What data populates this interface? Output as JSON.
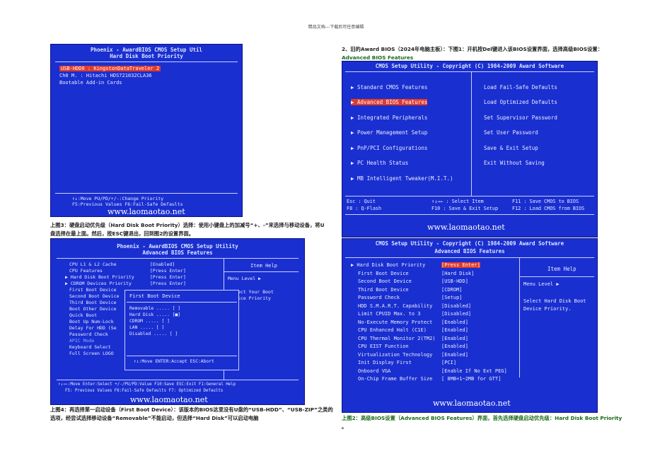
{
  "page": {
    "header": "精品文档---下载后可任意编辑"
  },
  "intro": {
    "text": "2、旧的Award BIOS（2024年电脑主板）：下图1：开机按Del键进入该BIOS设置界面，选择高级BIOS设置：",
    "highlight": "Advanced BIOS Features"
  },
  "shot_tl": {
    "title1": "Phoenix - AwardBIOS CMOS Setup Util",
    "title2": "Hard Disk Boot Priority",
    "items": [
      "USB-HDD0   :  KingstonDataTraveler 2",
      "Ch0 M.     :  Hitachi HDS721032CLA36",
      "Bootable Add-in Cards"
    ],
    "footer1": "↑↓:Move    PU/PD/+/-:Change Priority",
    "footer2": "F5:Previous Values    F6:Fail-Safe Defaults",
    "watermark": "www.laomaotao.net"
  },
  "caption3": "上图3：硬盘启动优先级（Hard Disk Boot Priority）选择：使用小键盘上的加减号“+、-”来选择与移动设备，将U盘选择在最上面。然后，按ESC键退出，回到图2的设置界面。",
  "shot_tr": {
    "title": "CMOS Setup Utility - Copyright (C) 1984-2009 Award Software",
    "left_items": [
      "▶ Standard CMOS Features",
      "▶ Advanced BIOS Features",
      "▶ Integrated Peripherals",
      "▶ Power Management Setup",
      "▶ PnP/PCI Configurations",
      "▶ PC Health Status",
      "▶ MB Intelligent Tweaker(M.I.T.)"
    ],
    "right_items": [
      "Load Fail-Safe Defaults",
      "Load Optimized Defaults",
      "Set Supervisor Password",
      "Set User Password",
      "Save & Exit Setup",
      "Exit Without Saving"
    ],
    "foot_l1": "Esc : Quit",
    "foot_l2": "F8  : Q-Flash",
    "foot_m1": "↑↓→← : Select Item",
    "foot_m2": "F10 : Save & Exit Setup",
    "foot_r1": "F11 : Save CMOS to BIOS",
    "foot_r2": "F12 : Load CMOS from BIOS",
    "watermark": "www.laomaotao.net"
  },
  "shot_bl": {
    "title1": "Phoenix - AwardBIOS CMOS Setup Utility",
    "title2": "Advanced BIOS Features",
    "items": [
      "CPU L1 & L2 Cache",
      "CPU Features",
      "▶ Hard Disk Boot Priority",
      "▶ CDROM Devices Priority",
      "First Boot Device",
      "Second Boot Device",
      "Third Boot Device",
      "Boot Other Device",
      "Quick Boot",
      "Boot Up Num-Lock",
      "Delay For HDD (Se",
      "Password Check",
      "APIC Mode",
      "Keyboard Select",
      "Full Screen LOGO"
    ],
    "values": [
      "[Enabled]",
      "[Press Enter]",
      "[Press Enter]",
      "[Press Enter]"
    ],
    "help_title": "Item Help",
    "help_menu": "Menu Level  ▶",
    "help_text": "ect Your Boot",
    "help_text2": "ice Priority",
    "popup_title": "First Boot Device",
    "popup_items": [
      "Removable      ..... [ ]",
      "Hard Disk      ..... [■]",
      "CDROM          ..... [ ]",
      "LAN            ..... [ ]",
      "Disabled       ..... [ ]"
    ],
    "popup_footer": "↑↓:Move ENTER:Accept ESC:Abort",
    "footer1": "↑↓→←:Move  Enter:Select  +/-/PU/PD:Value  F10:Save  ESC:Exit  F1:General Help",
    "footer2": "F5: Previous Values    F6:Fail-Safe Defaults    F7: Optimized Defaults",
    "watermark": "www.laomaotao.net"
  },
  "caption4": "上图4：再选择第一启动设备（First Boot Device）：该版本的BIOS这里没有U盘的“USB-HDD”、“USB-ZIP”之类的选项，经尝试选择移动设备“Removable”不能启动，但选择“Hard Disk”可以启动电脑",
  "shot_br": {
    "title1": "CMOS Setup Utility - Copyright (C) 1984-2009 Award Software",
    "title2": "Advanced BIOS Features",
    "items": [
      "▶ Hard Disk Boot Priority",
      "First Boot Device",
      "Second Boot Device",
      "Third Boot Device",
      "Password Check",
      "HDD S.M.A.R.T. Capability",
      "Limit CPUID Max. to 3",
      "No-Execute Memory Protect",
      "CPU Enhanced Halt (C1E)",
      "CPU Thermal Monitor 2(TM2)",
      "CPU EIST Function",
      "Virtualization Technology",
      "Init Display First",
      "Onboard VGA",
      "On-Chip Frame Buffer Size"
    ],
    "values": [
      "[Press Enter]",
      "[Hard Disk]",
      "[USB-HDD]",
      "[CDROM]",
      "[Setup]",
      "[Disabled]",
      "[Disabled]",
      "[Enabled]",
      "[Enabled]",
      "[Enabled]",
      "[Enabled]",
      "[Enabled]",
      "[PCI]",
      "[Enable If No Ext PEG]",
      "[ 8MB+1~2MB for GTT]"
    ],
    "help_title": "Item Help",
    "help_menu": "Menu Level  ▶",
    "help_text1": "Select Hard Disk Boot",
    "help_text2": "Device Priority.",
    "watermark": "www.laomaotao.net"
  },
  "caption2": "上图2：高级BIOS设置（Advanced BIOS Features）界面，首先选择硬盘启动优先级：Hard Disk Boot Priority",
  "caption2_end": "。"
}
